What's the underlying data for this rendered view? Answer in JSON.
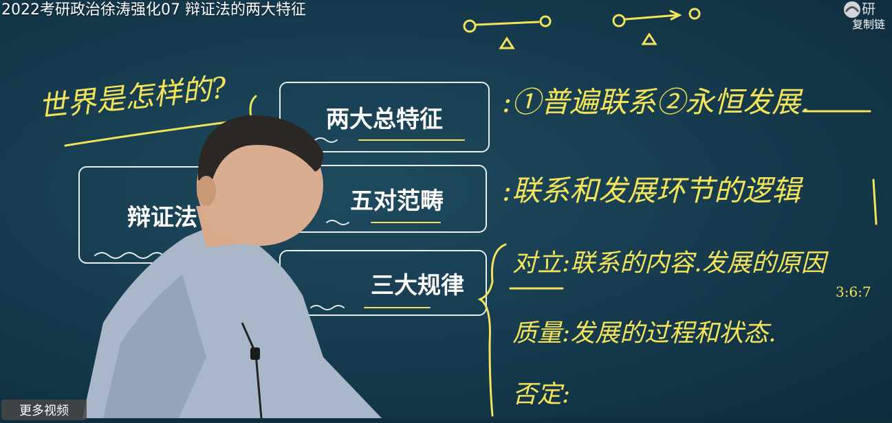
{
  "video": {
    "title": "2022考研政治徐涛强化07 辩证法的两大特征",
    "brand": "研",
    "copy_link": "复制链",
    "more_videos": "更多视频"
  },
  "board": {
    "boxes": {
      "dialectics": "辩证法",
      "two_features": "两大总特征",
      "five_categories": "五对范畴",
      "three_laws": "三大规律"
    },
    "handwriting": {
      "question": "世界是怎样的?",
      "line1": ":①普遍联系②永恒发展.",
      "line2": ":联系和发展环节的逻辑",
      "line3": "对立:联系的内容.发展的原因",
      "line4": "质量:发展的过程和状态.",
      "line5": "否定:"
    }
  },
  "colors": {
    "chalk_yellow": "#f3e45a",
    "box_border": "#e7eef2",
    "board_bg": "#173c50"
  }
}
